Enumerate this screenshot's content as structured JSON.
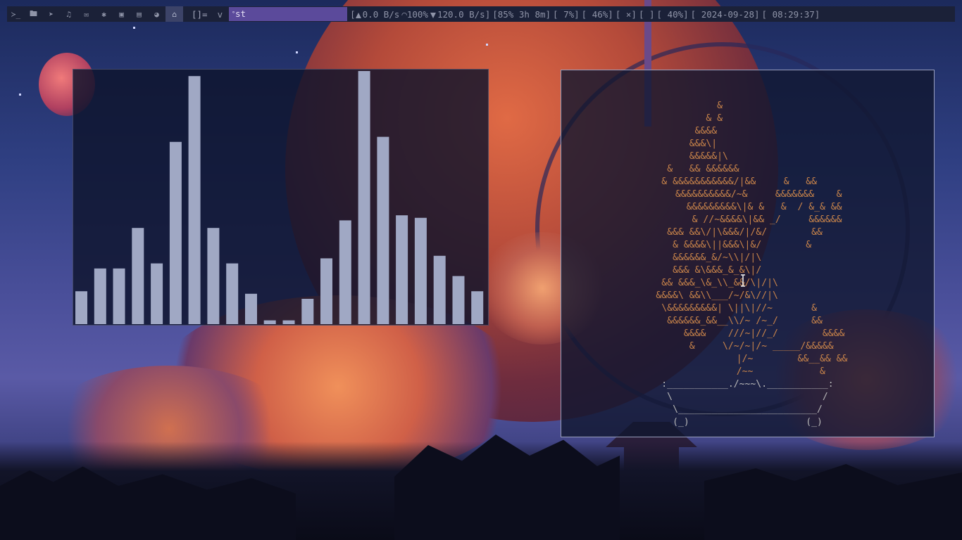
{
  "taskbar": {
    "tags": [
      {
        "name": "terminal-icon",
        "glyph": "≻_",
        "active": false
      },
      {
        "name": "folder-icon",
        "glyph": "🖿",
        "active": false
      },
      {
        "name": "send-icon",
        "glyph": "➤",
        "active": false
      },
      {
        "name": "music-icon",
        "glyph": "♫",
        "active": false
      },
      {
        "name": "mail-icon",
        "glyph": "✉",
        "active": false
      },
      {
        "name": "bug-icon",
        "glyph": "✱",
        "active": false
      },
      {
        "name": "image-icon",
        "glyph": "▣",
        "active": false
      },
      {
        "name": "film-icon",
        "glyph": "▤",
        "active": false
      },
      {
        "name": "browser-icon",
        "glyph": "◕",
        "active": false
      },
      {
        "name": "bank-icon",
        "glyph": "⌂",
        "active": true
      }
    ],
    "layout_symbol": "[]=",
    "client_name": "v",
    "window_title": "st",
    "status": {
      "upload": "0.0 B/s",
      "wifi": "100%",
      "download": "120.0 B/s]",
      "battery": "[85% 3h 8m]",
      "cpu": "[ 7%]",
      "memory": "[ 46%]",
      "volume": "[ ×]",
      "mic": "[ ]",
      "brightness": "[ 40%]",
      "date": "[ 2024-09-28]",
      "time": "[ 08:29:37]"
    }
  },
  "visualizer": {
    "max_level": 1.0,
    "levels": [
      0.13,
      0.22,
      0.22,
      0.38,
      0.24,
      0.72,
      0.98,
      0.38,
      0.24,
      0.12,
      0.015,
      0.015,
      0.1,
      0.26,
      0.41,
      1.0,
      0.74,
      0.43,
      0.42,
      0.27,
      0.19,
      0.13
    ],
    "bar_color": "#a0a8c4"
  },
  "ascii_bonsai": {
    "lines": [
      "           &                     ",
      "         & &                     ",
      "       &&&&                      ",
      "      &&&\\|                      ",
      "      &&&&&|\\                    ",
      "  &   && &&&&&&                  ",
      " & &&&&&&&&&&&/|&&     &   &&    ",
      "    &&&&&&&&&&/~&     &&&&&&&    &",
      "      &&&&&&&&&\\|& &   &  / &_& &&",
      "       & //~&&&&\\|&& _/     &&&&&&",
      "  &&& &&\\/|\\&&&/|/&/        &&   ",
      "   & &&&&\\||&&&\\|&/        &     ",
      "   &&&&&&_&/~\\\\|/|\\              ",
      "   &&& &\\&&&_&_&\\|/              ",
      " && &&&_\\&_\\\\_&&/\\|/|\\           ",
      "&&&&\\ &&\\\\___/~/&\\//|\\           ",
      " \\&&&&&&&&&| \\||\\|//~       &    ",
      "  &&&&&&_&&__\\\\/~ /~_/      &&   ",
      "      &&&&    ///~|//_/        &&&&",
      "      &     \\/~/~|/~ _____/&&&&& ",
      "                |/~        &&__&& &&",
      "               /~~            &   "
    ],
    "pot": [
      ":___________./~~~\\.___________:",
      " \\                           / ",
      "  \\_________________________/  ",
      "  (_)                     (_)  "
    ]
  }
}
